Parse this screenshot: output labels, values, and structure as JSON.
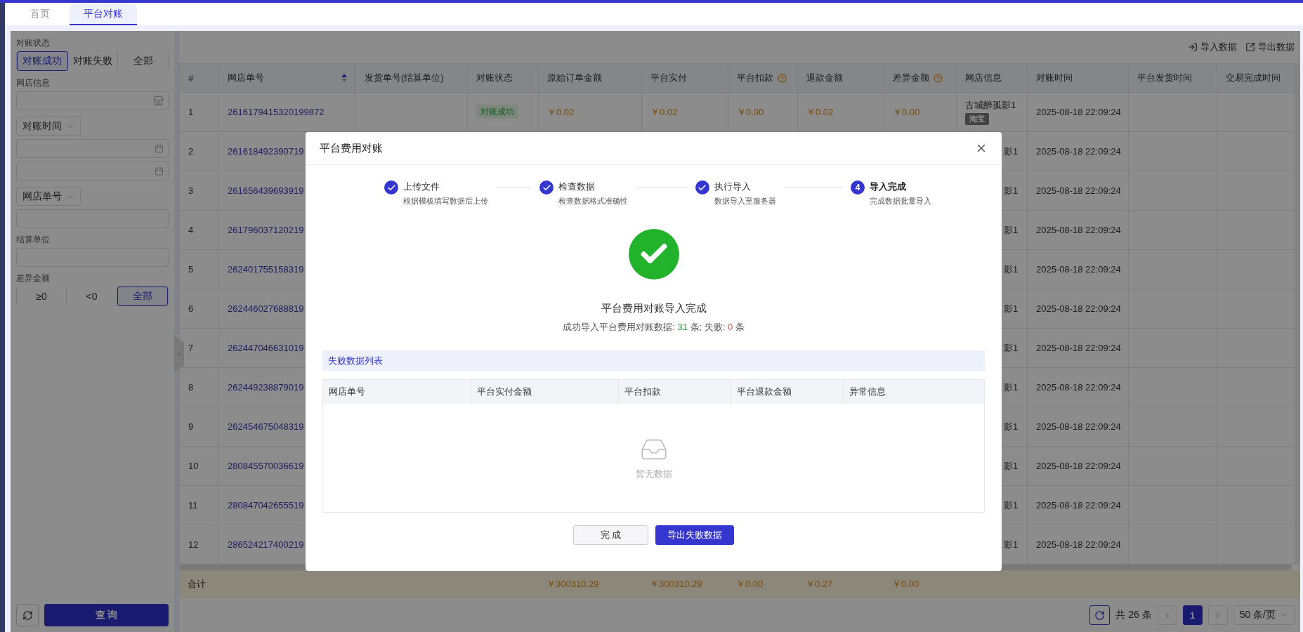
{
  "tabs": [
    {
      "label": "首页",
      "selected": false
    },
    {
      "label": "平台对账",
      "selected": true
    }
  ],
  "filters": {
    "status": {
      "label": "对账状态",
      "options": [
        {
          "label": "对账成功",
          "selected": true
        },
        {
          "label": "对账失败",
          "selected": false
        },
        {
          "label": "全部",
          "selected": false
        }
      ]
    },
    "shop": {
      "label": "网店信息"
    },
    "time_select": {
      "value": "对账时间"
    },
    "order_select": {
      "value": "网店单号"
    },
    "settlement": {
      "label": "结算单位"
    },
    "difference": {
      "label": "差异金额",
      "options": [
        {
          "label": "≥0",
          "selected": false
        },
        {
          "label": "<0",
          "selected": false
        },
        {
          "label": "全部",
          "selected": true
        }
      ]
    },
    "query_button": "查 询"
  },
  "toolbar": {
    "buttons": [
      {
        "label": "导入数据",
        "kind": "import"
      },
      {
        "label": "导出数据",
        "kind": "export"
      }
    ]
  },
  "table": {
    "columns": [
      {
        "label": "#",
        "sortable": false,
        "help": false
      },
      {
        "label": "网店单号",
        "sortable": true,
        "help": false
      },
      {
        "label": "发货单号(结算单位)",
        "sortable": false,
        "help": false
      },
      {
        "label": "对账状态",
        "sortable": false,
        "help": false
      },
      {
        "label": "原始订单金额",
        "sortable": false,
        "help": false
      },
      {
        "label": "平台实付",
        "sortable": false,
        "help": false
      },
      {
        "label": "平台扣款",
        "sortable": false,
        "help": true
      },
      {
        "label": "退款金额",
        "sortable": false,
        "help": false
      },
      {
        "label": "差异金额",
        "sortable": false,
        "help": true
      },
      {
        "label": "网店信息",
        "sortable": false,
        "help": false
      },
      {
        "label": "对账时间",
        "sortable": false,
        "help": false
      },
      {
        "label": "平台发货时间",
        "sortable": false,
        "help": false
      },
      {
        "label": "交易完成时间",
        "sortable": false,
        "help": false
      }
    ],
    "rows": [
      {
        "kind": "full",
        "index": "1",
        "order_no": "2616179415320199872",
        "status": "对账成功",
        "original_amount": "￥0.02",
        "paid": "￥0.02",
        "deduction": "￥0.00",
        "refund": "￥0.02",
        "difference": "￥0.00",
        "shop": "古城醉孤影1",
        "shop_tag": "淘宝",
        "reconcile_time": "2025-08-18 22:09:24"
      },
      {
        "kind": "covered",
        "index": "2",
        "order_no": "261618492390719",
        "shop": "影1",
        "reconcile_time": "2025-08-18 22:09:24"
      },
      {
        "kind": "covered",
        "index": "3",
        "order_no": "261656439693919",
        "shop": "影1",
        "reconcile_time": "2025-08-18 22:09:24"
      },
      {
        "kind": "covered",
        "index": "4",
        "order_no": "261796037120219",
        "shop": "影1",
        "reconcile_time": "2025-08-18 22:09:24"
      },
      {
        "kind": "covered",
        "index": "5",
        "order_no": "262401755158319",
        "shop": "影1",
        "reconcile_time": "2025-08-18 22:09:24"
      },
      {
        "kind": "covered",
        "index": "6",
        "order_no": "262446027688819",
        "shop": "影1",
        "reconcile_time": "2025-08-18 22:09:24"
      },
      {
        "kind": "covered",
        "index": "7",
        "order_no": "262447046631019",
        "shop": "影1",
        "reconcile_time": "2025-08-18 22:09:24"
      },
      {
        "kind": "covered",
        "index": "8",
        "order_no": "262449238879019",
        "shop": "影1",
        "reconcile_time": "2025-08-18 22:09:24"
      },
      {
        "kind": "covered",
        "index": "9",
        "order_no": "262454675048319",
        "shop": "影1",
        "reconcile_time": "2025-08-18 22:09:24"
      },
      {
        "kind": "covered",
        "index": "10",
        "order_no": "280845570036619",
        "shop": "影1",
        "reconcile_time": "2025-08-18 22:09:24"
      },
      {
        "kind": "covered",
        "index": "11",
        "order_no": "280847042655519",
        "shop": "影1",
        "reconcile_time": "2025-08-18 22:09:24"
      },
      {
        "kind": "covered",
        "index": "12",
        "order_no": "286524217400219",
        "shop": "影1",
        "reconcile_time": "2025-08-18 22:09:24"
      }
    ],
    "totals": {
      "label": "合计",
      "original_amount": "￥300310.29",
      "paid": "￥300310.29",
      "deduction": "￥0.00",
      "refund": "￥0.27",
      "difference": "￥0.00"
    }
  },
  "pagination": {
    "total": "共 26 条",
    "pages": [
      {
        "label": "1",
        "selected": true
      }
    ],
    "page_size": "50 条/页"
  },
  "modal": {
    "title": "平台费用对账",
    "steps": [
      {
        "title": "上传文件",
        "subtitle": "根据模板填写数据后上传",
        "completed": true
      },
      {
        "title": "检查数据",
        "subtitle": "检查数据格式准确性",
        "completed": true
      },
      {
        "title": "执行导入",
        "subtitle": "数据导入至服务器",
        "completed": true
      },
      {
        "title": "导入完成",
        "subtitle": "完成数据批量导入",
        "completed": false,
        "number": "4"
      }
    ],
    "result": {
      "title": "平台费用对账导入完成",
      "summary": {
        "prefix": "成功导入平台费用对账数据: ",
        "success_count": "31",
        "middle": " 条; 失败: ",
        "fail_count": "0",
        "suffix": " 条"
      }
    },
    "failures": {
      "title": "失败数据列表",
      "columns": [
        "网店单号",
        "平台实付金额",
        "平台扣款",
        "平台退款金额",
        "异常信息"
      ],
      "empty_text": "暂无数据"
    },
    "buttons": [
      {
        "label": "完 成",
        "kind": "default"
      },
      {
        "label": "导出失败数据",
        "kind": "primary"
      }
    ]
  }
}
